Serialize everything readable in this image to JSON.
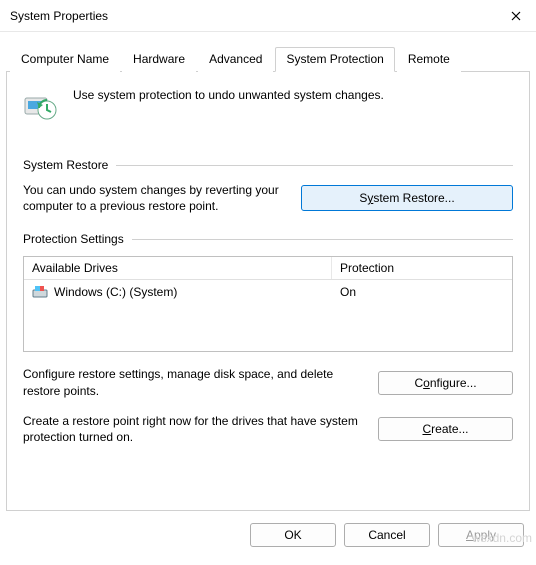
{
  "window": {
    "title": "System Properties"
  },
  "tabs": {
    "computer_name": "Computer Name",
    "hardware": "Hardware",
    "advanced": "Advanced",
    "system_protection": "System Protection",
    "remote": "Remote"
  },
  "intro": {
    "text": "Use system protection to undo unwanted system changes."
  },
  "sections": {
    "system_restore": {
      "header": "System Restore",
      "desc": "You can undo system changes by reverting your computer to a previous restore point.",
      "button_pre": "S",
      "button_u": "y",
      "button_post": "stem Restore..."
    },
    "protection_settings": {
      "header": "Protection Settings",
      "col_drives": "Available Drives",
      "col_protection": "Protection",
      "rows": [
        {
          "name": "Windows (C:) (System)",
          "protection": "On"
        }
      ],
      "configure_desc": "Configure restore settings, manage disk space, and delete restore points.",
      "configure_pre": "C",
      "configure_u": "o",
      "configure_post": "nfigure...",
      "create_desc": "Create a restore point right now for the drives that have system protection turned on.",
      "create_pre": "",
      "create_u": "C",
      "create_post": "reate..."
    }
  },
  "footer": {
    "ok": "OK",
    "cancel": "Cancel",
    "apply_pre": "",
    "apply_u": "A",
    "apply_post": "pply"
  },
  "watermark": "wsxdn.com"
}
